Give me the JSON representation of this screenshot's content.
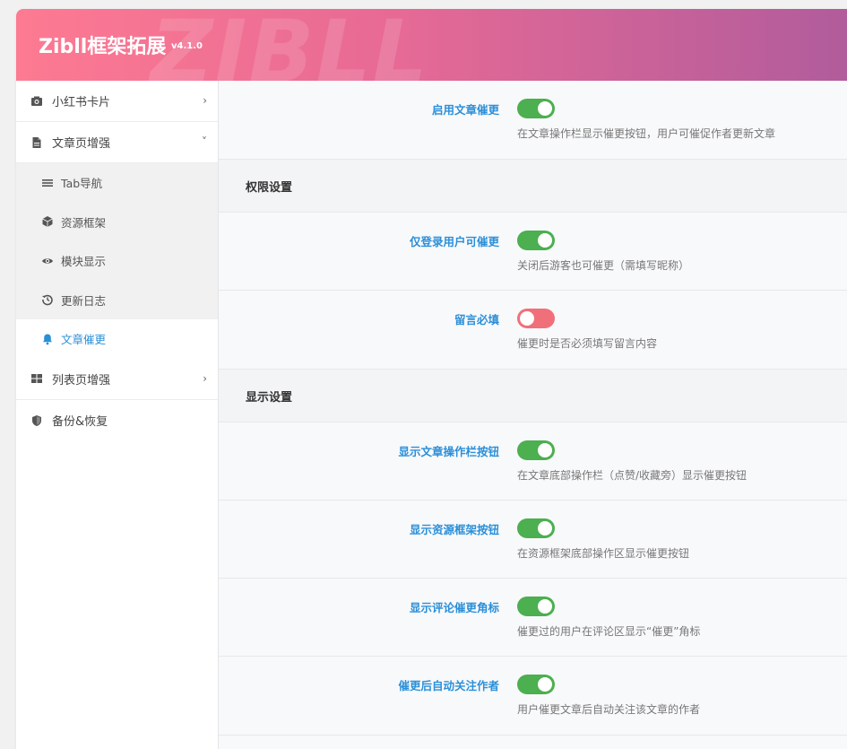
{
  "header": {
    "brand": "Zibll框架拓展",
    "version": "v4.1.0",
    "watermark": "ZIBLL"
  },
  "sidebar": {
    "items": [
      {
        "label": "小红书卡片",
        "icon": "camera-icon",
        "chevron": "›"
      },
      {
        "label": "文章页增强",
        "icon": "document-icon",
        "chevron": "˅",
        "children": [
          {
            "label": "Tab导航",
            "icon": "menu-lines-icon"
          },
          {
            "label": "资源框架",
            "icon": "cube-icon"
          },
          {
            "label": "模块显示",
            "icon": "eye-icon"
          },
          {
            "label": "更新日志",
            "icon": "history-icon"
          },
          {
            "label": "文章催更",
            "icon": "bell-icon",
            "active": true
          }
        ]
      },
      {
        "label": "列表页增强",
        "icon": "grid-icon",
        "chevron": "›"
      },
      {
        "label": "备份&恢复",
        "icon": "shield-icon"
      }
    ]
  },
  "content": {
    "top_setting": {
      "label": "启用文章催更",
      "on": true,
      "desc": "在文章操作栏显示催更按钮，用户可催促作者更新文章"
    },
    "sections": [
      {
        "title": "权限设置",
        "settings": [
          {
            "label": "仅登录用户可催更",
            "on": true,
            "desc": "关闭后游客也可催更（需填写昵称）"
          },
          {
            "label": "留言必填",
            "on": false,
            "desc": "催更时是否必须填写留言内容"
          }
        ]
      },
      {
        "title": "显示设置",
        "settings": [
          {
            "label": "显示文章操作栏按钮",
            "on": true,
            "desc": "在文章底部操作栏（点赞/收藏旁）显示催更按钮"
          },
          {
            "label": "显示资源框架按钮",
            "on": true,
            "desc": "在资源框架底部操作区显示催更按钮"
          },
          {
            "label": "显示评论催更角标",
            "on": true,
            "desc": "催更过的用户在评论区显示“催更”角标"
          },
          {
            "label": "催更后自动关注作者",
            "on": true,
            "desc": "用户催更文章后自动关注该文章的作者"
          }
        ]
      }
    ]
  },
  "colors": {
    "accent": "#2b8fd8",
    "toggle_on": "#4caf50",
    "toggle_off": "#f0707a",
    "header_start": "#fd7a92",
    "header_end": "#b15c9c"
  }
}
